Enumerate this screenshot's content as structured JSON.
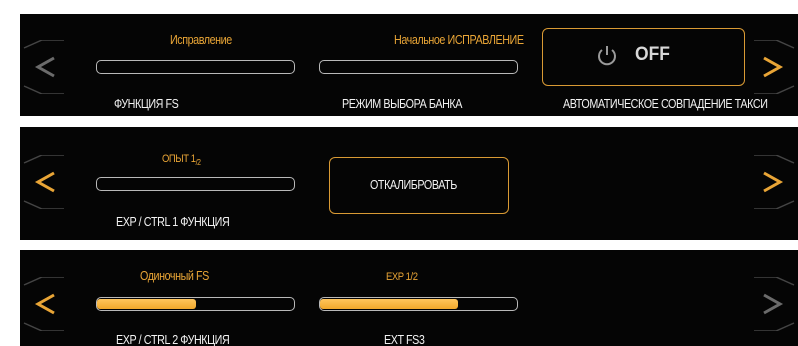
{
  "colors": {
    "accent": "#e9a536",
    "text": "#f2f2f2",
    "background": "#050505",
    "field_border": "#b9b9b9",
    "nav_active": "#e9a536",
    "nav_inactive": "#6b6b6b"
  },
  "panel1": {
    "label1": "Исправление",
    "label2": "Начальное ИСПРАВЛЕНИЕ",
    "field1_label": "ФУНКЦИЯ FS",
    "field2_label": "РЕЖИМ ВЫБОРА БАНКА",
    "toggle_value": "OFF",
    "toggle_icon": "power-icon",
    "toggle_label": "АВТОМАТИЧЕСКОЕ СОВПАДЕНИЕ ТАКСИ"
  },
  "panel2": {
    "label1": "ОПЫТ 1",
    "label1_suffix": "/2",
    "field1_label": "EXP / CTRL 1 ФУНКЦИЯ",
    "calibrate_label": "ОТКАЛИБРОВАТЬ"
  },
  "panel3": {
    "label1": "Одиночный FS",
    "label2": "EXP 1/2",
    "field1_label": "EXP / CTRL 2 ФУНКЦИЯ",
    "field2_label": "EXT FS3",
    "field1_level": 0.5,
    "field2_level": 0.7
  }
}
